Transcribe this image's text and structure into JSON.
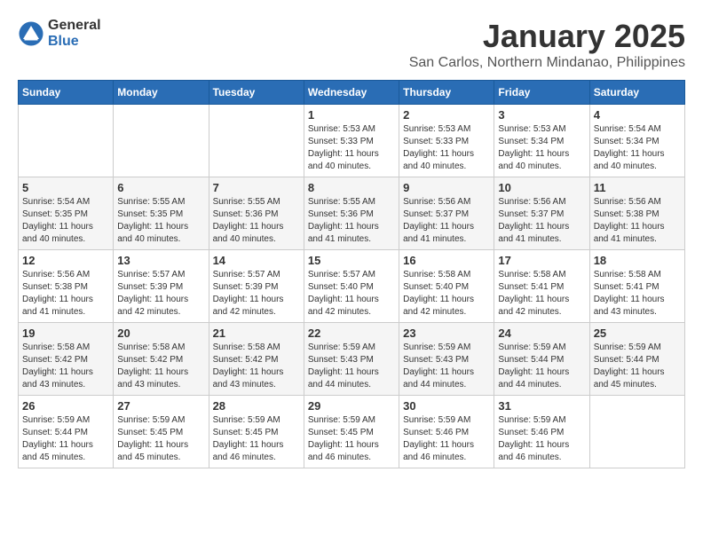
{
  "logo": {
    "general": "General",
    "blue": "Blue"
  },
  "title": "January 2025",
  "location": "San Carlos, Northern Mindanao, Philippines",
  "weekdays": [
    "Sunday",
    "Monday",
    "Tuesday",
    "Wednesday",
    "Thursday",
    "Friday",
    "Saturday"
  ],
  "weeks": [
    [
      {
        "day": "",
        "info": ""
      },
      {
        "day": "",
        "info": ""
      },
      {
        "day": "",
        "info": ""
      },
      {
        "day": "1",
        "info": "Sunrise: 5:53 AM\nSunset: 5:33 PM\nDaylight: 11 hours\nand 40 minutes."
      },
      {
        "day": "2",
        "info": "Sunrise: 5:53 AM\nSunset: 5:33 PM\nDaylight: 11 hours\nand 40 minutes."
      },
      {
        "day": "3",
        "info": "Sunrise: 5:53 AM\nSunset: 5:34 PM\nDaylight: 11 hours\nand 40 minutes."
      },
      {
        "day": "4",
        "info": "Sunrise: 5:54 AM\nSunset: 5:34 PM\nDaylight: 11 hours\nand 40 minutes."
      }
    ],
    [
      {
        "day": "5",
        "info": "Sunrise: 5:54 AM\nSunset: 5:35 PM\nDaylight: 11 hours\nand 40 minutes."
      },
      {
        "day": "6",
        "info": "Sunrise: 5:55 AM\nSunset: 5:35 PM\nDaylight: 11 hours\nand 40 minutes."
      },
      {
        "day": "7",
        "info": "Sunrise: 5:55 AM\nSunset: 5:36 PM\nDaylight: 11 hours\nand 40 minutes."
      },
      {
        "day": "8",
        "info": "Sunrise: 5:55 AM\nSunset: 5:36 PM\nDaylight: 11 hours\nand 41 minutes."
      },
      {
        "day": "9",
        "info": "Sunrise: 5:56 AM\nSunset: 5:37 PM\nDaylight: 11 hours\nand 41 minutes."
      },
      {
        "day": "10",
        "info": "Sunrise: 5:56 AM\nSunset: 5:37 PM\nDaylight: 11 hours\nand 41 minutes."
      },
      {
        "day": "11",
        "info": "Sunrise: 5:56 AM\nSunset: 5:38 PM\nDaylight: 11 hours\nand 41 minutes."
      }
    ],
    [
      {
        "day": "12",
        "info": "Sunrise: 5:56 AM\nSunset: 5:38 PM\nDaylight: 11 hours\nand 41 minutes."
      },
      {
        "day": "13",
        "info": "Sunrise: 5:57 AM\nSunset: 5:39 PM\nDaylight: 11 hours\nand 42 minutes."
      },
      {
        "day": "14",
        "info": "Sunrise: 5:57 AM\nSunset: 5:39 PM\nDaylight: 11 hours\nand 42 minutes."
      },
      {
        "day": "15",
        "info": "Sunrise: 5:57 AM\nSunset: 5:40 PM\nDaylight: 11 hours\nand 42 minutes."
      },
      {
        "day": "16",
        "info": "Sunrise: 5:58 AM\nSunset: 5:40 PM\nDaylight: 11 hours\nand 42 minutes."
      },
      {
        "day": "17",
        "info": "Sunrise: 5:58 AM\nSunset: 5:41 PM\nDaylight: 11 hours\nand 42 minutes."
      },
      {
        "day": "18",
        "info": "Sunrise: 5:58 AM\nSunset: 5:41 PM\nDaylight: 11 hours\nand 43 minutes."
      }
    ],
    [
      {
        "day": "19",
        "info": "Sunrise: 5:58 AM\nSunset: 5:42 PM\nDaylight: 11 hours\nand 43 minutes."
      },
      {
        "day": "20",
        "info": "Sunrise: 5:58 AM\nSunset: 5:42 PM\nDaylight: 11 hours\nand 43 minutes."
      },
      {
        "day": "21",
        "info": "Sunrise: 5:58 AM\nSunset: 5:42 PM\nDaylight: 11 hours\nand 43 minutes."
      },
      {
        "day": "22",
        "info": "Sunrise: 5:59 AM\nSunset: 5:43 PM\nDaylight: 11 hours\nand 44 minutes."
      },
      {
        "day": "23",
        "info": "Sunrise: 5:59 AM\nSunset: 5:43 PM\nDaylight: 11 hours\nand 44 minutes."
      },
      {
        "day": "24",
        "info": "Sunrise: 5:59 AM\nSunset: 5:44 PM\nDaylight: 11 hours\nand 44 minutes."
      },
      {
        "day": "25",
        "info": "Sunrise: 5:59 AM\nSunset: 5:44 PM\nDaylight: 11 hours\nand 45 minutes."
      }
    ],
    [
      {
        "day": "26",
        "info": "Sunrise: 5:59 AM\nSunset: 5:44 PM\nDaylight: 11 hours\nand 45 minutes."
      },
      {
        "day": "27",
        "info": "Sunrise: 5:59 AM\nSunset: 5:45 PM\nDaylight: 11 hours\nand 45 minutes."
      },
      {
        "day": "28",
        "info": "Sunrise: 5:59 AM\nSunset: 5:45 PM\nDaylight: 11 hours\nand 46 minutes."
      },
      {
        "day": "29",
        "info": "Sunrise: 5:59 AM\nSunset: 5:45 PM\nDaylight: 11 hours\nand 46 minutes."
      },
      {
        "day": "30",
        "info": "Sunrise: 5:59 AM\nSunset: 5:46 PM\nDaylight: 11 hours\nand 46 minutes."
      },
      {
        "day": "31",
        "info": "Sunrise: 5:59 AM\nSunset: 5:46 PM\nDaylight: 11 hours\nand 46 minutes."
      },
      {
        "day": "",
        "info": ""
      }
    ]
  ]
}
